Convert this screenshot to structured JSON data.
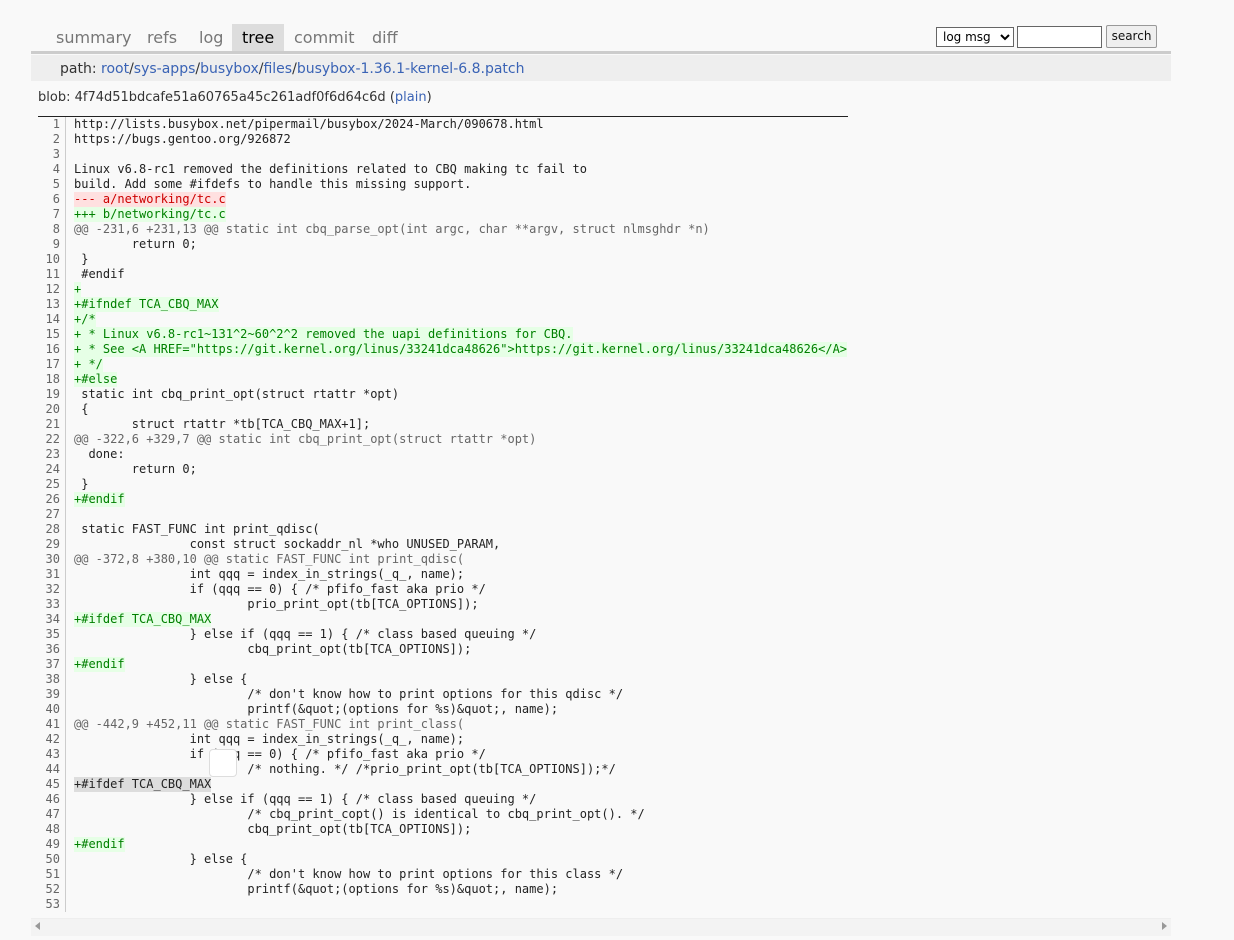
{
  "tabs": [
    {
      "label": "summary",
      "active": false
    },
    {
      "label": "refs",
      "active": false
    },
    {
      "label": "log",
      "active": false
    },
    {
      "label": "tree",
      "active": true
    },
    {
      "label": "commit",
      "active": false
    },
    {
      "label": "diff",
      "active": false
    }
  ],
  "search": {
    "select_value": "log msg",
    "input_value": "",
    "button_label": "search"
  },
  "path": {
    "label": "path: ",
    "parts": [
      "root",
      "sys-apps",
      "busybox",
      "files",
      "busybox-1.36.1-kernel-6.8.patch"
    ]
  },
  "blob": {
    "label": "blob: ",
    "hash": "4f74d51bdcafe51a60765a45c261adf0f6d64c6d",
    "open_paren": " (",
    "plain_label": "plain",
    "close_paren": ")"
  },
  "code": {
    "lines": [
      {
        "n": "1",
        "t": "http://lists.busybox.net/pipermail/busybox/2024-March/090678.html",
        "k": ""
      },
      {
        "n": "2",
        "t": "https://bugs.gentoo.org/926872",
        "k": ""
      },
      {
        "n": "3",
        "t": "",
        "k": ""
      },
      {
        "n": "4",
        "t": "Linux v6.8-rc1 removed the definitions related to CBQ making tc fail to",
        "k": ""
      },
      {
        "n": "5",
        "t": "build. Add some #ifdefs to handle this missing support.",
        "k": ""
      },
      {
        "n": "6",
        "t": "--- a/networking/tc.c",
        "k": "del"
      },
      {
        "n": "7",
        "t": "+++ b/networking/tc.c",
        "k": "add"
      },
      {
        "n": "8",
        "t": "@@ -231,6 +231,13 @@ static int cbq_parse_opt(int argc, char **argv, struct nlmsghdr *n)",
        "k": "hunk"
      },
      {
        "n": "9",
        "t": "        return 0;",
        "k": ""
      },
      {
        "n": "10",
        "t": " }",
        "k": ""
      },
      {
        "n": "11",
        "t": " #endif",
        "k": ""
      },
      {
        "n": "12",
        "t": "+",
        "k": "add"
      },
      {
        "n": "13",
        "t": "+#ifndef TCA_CBQ_MAX",
        "k": "add"
      },
      {
        "n": "14",
        "t": "+/*",
        "k": "add"
      },
      {
        "n": "15",
        "t": "+ * Linux v6.8-rc1~131^2~60^2^2 removed the uapi definitions for CBQ.",
        "k": "add"
      },
      {
        "n": "16",
        "t": "+ * See <A HREF=\"https://git.kernel.org/linus/33241dca48626\">https://git.kernel.org/linus/33241dca48626</A>",
        "k": "add"
      },
      {
        "n": "17",
        "t": "+ */",
        "k": "add"
      },
      {
        "n": "18",
        "t": "+#else",
        "k": "add"
      },
      {
        "n": "19",
        "t": " static int cbq_print_opt(struct rtattr *opt)",
        "k": ""
      },
      {
        "n": "20",
        "t": " {",
        "k": ""
      },
      {
        "n": "21",
        "t": "        struct rtattr *tb[TCA_CBQ_MAX+1];",
        "k": ""
      },
      {
        "n": "22",
        "t": "@@ -322,6 +329,7 @@ static int cbq_print_opt(struct rtattr *opt)",
        "k": "hunk"
      },
      {
        "n": "23",
        "t": "  done:",
        "k": ""
      },
      {
        "n": "24",
        "t": "        return 0;",
        "k": ""
      },
      {
        "n": "25",
        "t": " }",
        "k": ""
      },
      {
        "n": "26",
        "t": "+#endif",
        "k": "add"
      },
      {
        "n": "27",
        "t": "",
        "k": ""
      },
      {
        "n": "28",
        "t": " static FAST_FUNC int print_qdisc(",
        "k": ""
      },
      {
        "n": "29",
        "t": "                const struct sockaddr_nl *who UNUSED_PARAM,",
        "k": ""
      },
      {
        "n": "30",
        "t": "@@ -372,8 +380,10 @@ static FAST_FUNC int print_qdisc(",
        "k": "hunk"
      },
      {
        "n": "31",
        "t": "                int qqq = index_in_strings(_q_, name);",
        "k": ""
      },
      {
        "n": "32",
        "t": "                if (qqq == 0) { /* pfifo_fast aka prio */",
        "k": ""
      },
      {
        "n": "33",
        "t": "                        prio_print_opt(tb[TCA_OPTIONS]);",
        "k": ""
      },
      {
        "n": "34",
        "t": "+#ifdef TCA_CBQ_MAX",
        "k": "add"
      },
      {
        "n": "35",
        "t": "                } else if (qqq == 1) { /* class based queuing */",
        "k": ""
      },
      {
        "n": "36",
        "t": "                        cbq_print_opt(tb[TCA_OPTIONS]);",
        "k": ""
      },
      {
        "n": "37",
        "t": "+#endif",
        "k": "add"
      },
      {
        "n": "38",
        "t": "                } else {",
        "k": ""
      },
      {
        "n": "39",
        "t": "                        /* don't know how to print options for this qdisc */",
        "k": ""
      },
      {
        "n": "40",
        "t": "                        printf(&quot;(options for %s)&quot;, name);",
        "k": ""
      },
      {
        "n": "41",
        "t": "@@ -442,9 +452,11 @@ static FAST_FUNC int print_class(",
        "k": "hunk"
      },
      {
        "n": "42",
        "t": "                int qqq = index_in_strings(_q_, name);",
        "k": ""
      },
      {
        "n": "43",
        "t": "                if (qqq == 0) { /* pfifo_fast aka prio */",
        "k": ""
      },
      {
        "n": "44",
        "t": "                        /* nothing. */ /*prio_print_opt(tb[TCA_OPTIONS]);*/",
        "k": ""
      },
      {
        "n": "45",
        "t": "+#ifdef TCA_CBQ_MAX",
        "k": "sel"
      },
      {
        "n": "46",
        "t": "                } else if (qqq == 1) { /* class based queuing */",
        "k": ""
      },
      {
        "n": "47",
        "t": "                        /* cbq_print_copt() is identical to cbq_print_opt(). */",
        "k": ""
      },
      {
        "n": "48",
        "t": "                        cbq_print_opt(tb[TCA_OPTIONS]);",
        "k": ""
      },
      {
        "n": "49",
        "t": "+#endif",
        "k": "add"
      },
      {
        "n": "50",
        "t": "                } else {",
        "k": ""
      },
      {
        "n": "51",
        "t": "                        /* don't know how to print options for this class */",
        "k": ""
      },
      {
        "n": "52",
        "t": "                        printf(&quot;(options for %s)&quot;, name);",
        "k": ""
      },
      {
        "n": "53",
        "t": "",
        "k": ""
      }
    ]
  },
  "colors": {
    "link": "#3a63b5",
    "added_bg": "#e6ffe6",
    "added_fg": "#008000",
    "deleted_bg": "#ffe0e0",
    "deleted_fg": "#cc0000",
    "hunk_fg": "#666666"
  },
  "icons": {
    "scroll_left": "scroll-left-arrow-icon",
    "scroll_right": "scroll-right-arrow-icon"
  }
}
